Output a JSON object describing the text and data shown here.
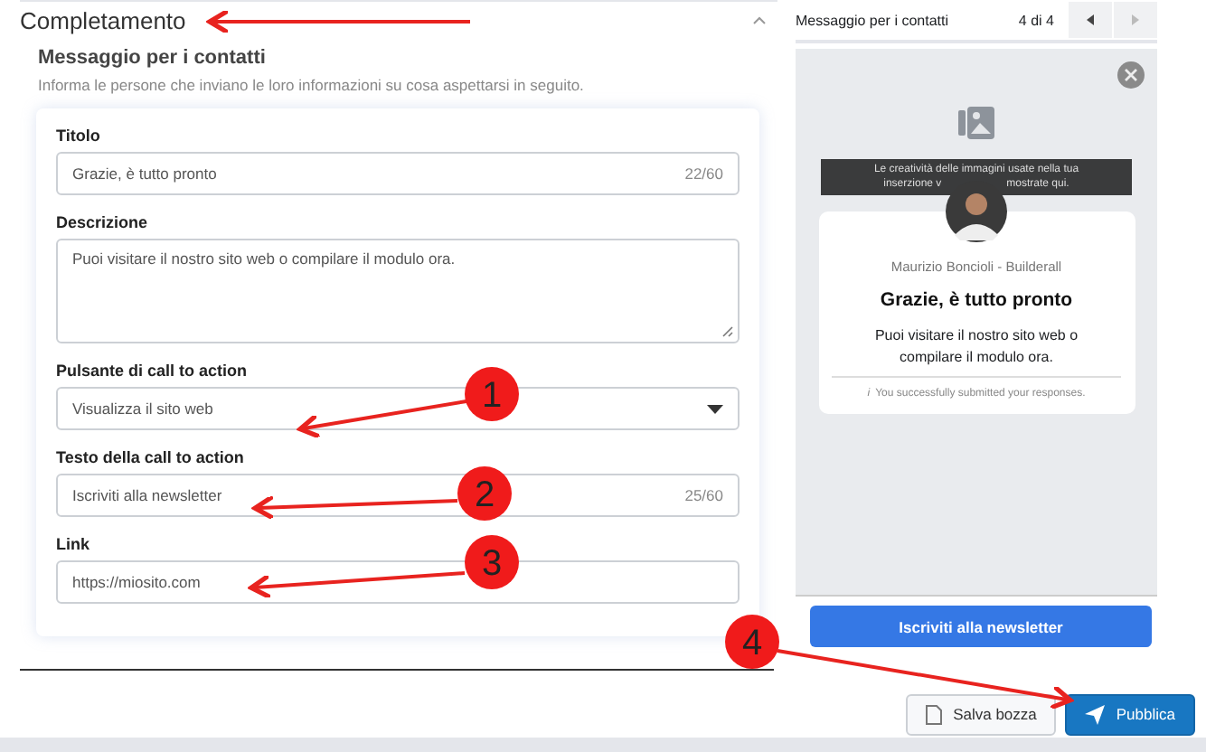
{
  "section": {
    "title": "Completamento",
    "expanded": true,
    "subtitle": "Messaggio per i contatti",
    "description": "Informa le persone che inviano le loro informazioni su cosa aspettarsi in seguito."
  },
  "fields": [
    {
      "kind": "input",
      "label": "Titolo",
      "value": "Grazie, è tutto pronto",
      "counter": "22/60"
    },
    {
      "kind": "textarea",
      "label": "Descrizione",
      "value": "Puoi visitare il nostro sito web o compilare il modulo ora."
    },
    {
      "kind": "select",
      "label": "Pulsante di call to action",
      "value": "Visualizza il sito web"
    },
    {
      "kind": "input",
      "label": "Testo della call to action",
      "value": "Iscriviti alla newsletter",
      "counter": "25/60"
    },
    {
      "kind": "input",
      "label": "Link",
      "value": "https://miosito.com"
    }
  ],
  "preview": {
    "title": "Messaggio per i contatti",
    "pager": "4 di 4",
    "banner_line1": "Le creatività delle immagini usate nella tua",
    "banner_line2_start": "inserzione v",
    "banner_line2_end": "mostrate qui.",
    "page_name": "Maurizio Boncioli - Builderall",
    "headline": "Grazie, è tutto pronto",
    "body": "Puoi visitare il nostro sito web o compilare il modulo ora.",
    "note_icon": "i",
    "note": "You successfully submitted your responses.",
    "cta": "Iscriviti alla newsletter"
  },
  "buttons": [
    {
      "kind": "secondary",
      "label": "Salva bozza"
    },
    {
      "kind": "primary",
      "label": "Pubblica"
    }
  ],
  "annotations": [
    {
      "kind": "arrow"
    },
    {
      "kind": "numbered",
      "number": "1"
    },
    {
      "kind": "numbered",
      "number": "2"
    },
    {
      "kind": "numbered",
      "number": "3"
    },
    {
      "kind": "numbered",
      "number": "4"
    }
  ]
}
